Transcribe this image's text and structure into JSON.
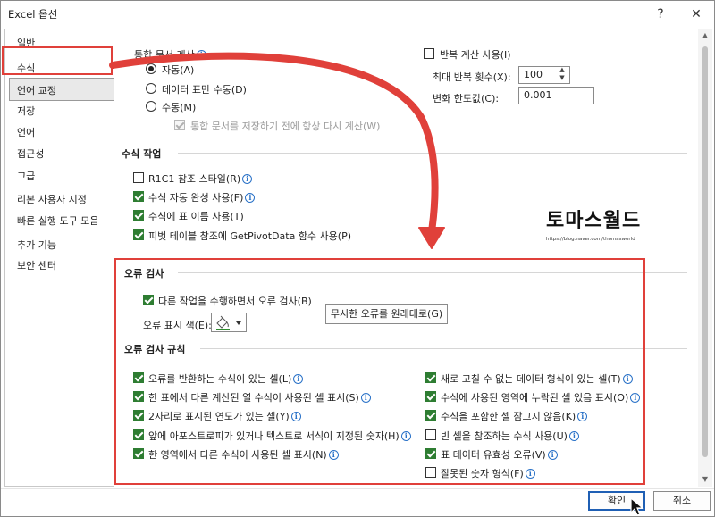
{
  "window": {
    "title": "Excel 옵션",
    "help_label": "?",
    "close_label": "✕"
  },
  "sidebar": {
    "items": [
      {
        "label": "일반"
      },
      {
        "label": "수식"
      },
      {
        "label": "언어 교정"
      },
      {
        "label": "저장"
      },
      {
        "label": "언어"
      },
      {
        "label": "접근성"
      },
      {
        "label": "고급"
      },
      {
        "label": "리본 사용자 지정"
      },
      {
        "label": "빠른 실행 도구 모음"
      },
      {
        "label": "추가 기능"
      },
      {
        "label": "보안 센터"
      }
    ],
    "selected": "수식"
  },
  "calc": {
    "workbook_calc_label": "통합 문서 계산",
    "auto": "자동(A)",
    "auto_except_tables": "데이터 표만 수동(D)",
    "manual": "수동(M)",
    "recalc_before_save": "통합 문서를 저장하기 전에 항상 다시 계산(W)",
    "iterative_label": "반복 계산 사용(I)",
    "max_iterations_label": "최대 반복 횟수(X):",
    "max_iterations_value": "100",
    "max_change_label": "변화 한도값(C):",
    "max_change_value": "0.001"
  },
  "formulas": {
    "section_title": "수식 작업",
    "r1c1": "R1C1 참조 스타일(R)",
    "autocomplete": "수식 자동 완성 사용(F)",
    "table_names": "수식에 표 이름 사용(T)",
    "getpivotdata": "피벗 테이블 참조에 GetPivotData 함수 사용(P)"
  },
  "error_checking": {
    "section_title": "오류 검사",
    "background": "다른 작업을 수행하면서 오류 검사(B)",
    "indicator_label": "오류 표시 색(E):",
    "reset_button": "무시한 오류를 원래대로(G)"
  },
  "rules": {
    "section_title": "오류 검사 규칙",
    "left": [
      {
        "label": "오류를 반환하는 수식이 있는 셀(L)",
        "checked": true
      },
      {
        "label": "한 표에서 다른 계산된 열 수식이 사용된 셀 표시(S)",
        "checked": true
      },
      {
        "label": "2자리로 표시된 연도가 있는 셀(Y)",
        "checked": true
      },
      {
        "label": "앞에 아포스트로피가 있거나 텍스트로 서식이 지정된 숫자(H)",
        "checked": true
      },
      {
        "label": "한 영역에서 다른 수식이 사용된 셀 표시(N)",
        "checked": true
      }
    ],
    "right": [
      {
        "label": "새로 고칠 수 없는 데이터 형식이 있는 셀(T)",
        "checked": true
      },
      {
        "label": "수식에 사용된 영역에 누락된 셀 있음 표시(O)",
        "checked": true
      },
      {
        "label": "수식을 포함한 셀 잠그지 않음(K)",
        "checked": true
      },
      {
        "label": "빈 셀을 참조하는 수식 사용(U)",
        "checked": false
      },
      {
        "label": "표 데이터 유효성 오류(V)",
        "checked": true
      },
      {
        "label": "잘못된 숫자 형식(F)",
        "checked": false
      }
    ]
  },
  "watermark": {
    "main": "토마스월드",
    "sub": "https://blog.naver.com/thomasworld"
  },
  "footer": {
    "ok_label": "확인",
    "cancel_label": "취소"
  },
  "colors": {
    "highlight": "#e0403a",
    "check": "#2e7d32",
    "primary_border": "#1f5fb4",
    "info": "#2a72c8"
  }
}
